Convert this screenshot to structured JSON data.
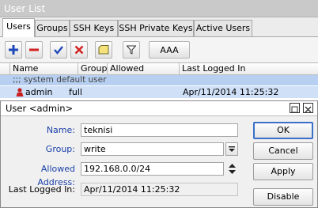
{
  "window": {
    "title": "User List"
  },
  "tabs": [
    {
      "label": "Users"
    },
    {
      "label": "Groups"
    },
    {
      "label": "SSH Keys"
    },
    {
      "label": "SSH Private Keys"
    },
    {
      "label": "Active Users"
    }
  ],
  "toolbar": {
    "aaa_label": "AAA"
  },
  "table": {
    "columns": [
      "Name",
      "Group",
      "Allowed Address",
      "Last Logged In"
    ],
    "group_header": ";;; system default user",
    "rows": [
      {
        "name": "admin",
        "group": "full",
        "allowed_address": "",
        "last_logged_in": "Apr/11/2014 11:25:32"
      }
    ]
  },
  "dialog": {
    "title": "User <admin>",
    "name_label": "Name:",
    "name_value": "teknisi",
    "group_label": "Group:",
    "group_value": "write",
    "allowed_label": "Allowed Address:",
    "allowed_value": "192.168.0.0/24",
    "last_label": "Last Logged In:",
    "last_value": "Apr/11/2014 11:25:32",
    "buttons": {
      "ok": "OK",
      "cancel": "Cancel",
      "apply": "Apply",
      "disable": "Disable"
    }
  },
  "colors": {
    "accent": "#3b6fc9",
    "selection": "#cfe0f7",
    "group_row": "#b7cff0"
  }
}
